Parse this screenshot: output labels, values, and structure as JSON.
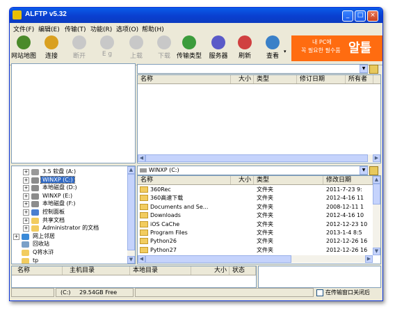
{
  "window": {
    "title": "ALFTP v5.32",
    "controls": [
      "_",
      "□",
      "×"
    ]
  },
  "menu": [
    "文件(F)",
    "编辑(E)",
    "传输(T)",
    "功能(R)",
    "选项(O)",
    "帮助(H)"
  ],
  "toolbar": [
    {
      "label": "网站地图",
      "icon": "site-map-icon",
      "enabled": true,
      "color": "#4a8a2a"
    },
    {
      "label": "连接",
      "icon": "connect-icon",
      "enabled": true,
      "color": "#d9a020"
    },
    {
      "label": "断开",
      "icon": "disconnect-icon",
      "enabled": false,
      "color": "#c8c8c8"
    },
    {
      "label": "E g",
      "icon": "edit-icon",
      "enabled": false,
      "color": "#c8c8c8"
    },
    {
      "label": "上载",
      "icon": "upload-icon",
      "enabled": false,
      "color": "#c8c8c8"
    },
    {
      "label": "下载",
      "icon": "download-icon",
      "enabled": false,
      "color": "#c8c8c8"
    },
    {
      "label": "传输类型",
      "icon": "transfer-type-icon",
      "enabled": true,
      "color": "#3c9c3c"
    },
    {
      "label": "服务器",
      "icon": "server-icon",
      "enabled": true,
      "color": "#5a5ac8"
    },
    {
      "label": "刷新",
      "icon": "refresh-icon",
      "enabled": true,
      "color": "#d04040"
    },
    {
      "label": "查看",
      "icon": "view-icon",
      "enabled": true,
      "color": "#3a80c8"
    }
  ],
  "ad_banner": {
    "line1": "내 PC에",
    "line2": "꼭 필요한 필수품",
    "big": "알툴"
  },
  "remote": {
    "path": "",
    "columns": [
      "名称",
      "大小",
      "类型",
      "修订日期",
      "所有者"
    ]
  },
  "local": {
    "path": "WINXP (C:)",
    "columns": [
      "名称",
      "大小",
      "类型",
      "修改日期"
    ],
    "rows": [
      {
        "name": "360Rec",
        "size": "",
        "type": "文件夹",
        "date": "2011-7-23 9:"
      },
      {
        "name": "360高速下载",
        "size": "",
        "type": "文件夹",
        "date": "2012-4-16 11"
      },
      {
        "name": "Documents and Se...",
        "size": "",
        "type": "文件夹",
        "date": "2008-12-11 1"
      },
      {
        "name": "Downloads",
        "size": "",
        "type": "文件夹",
        "date": "2012-4-16 10"
      },
      {
        "name": "iOS CaChe",
        "size": "",
        "type": "文件夹",
        "date": "2012-12-23 10"
      },
      {
        "name": "Program Files",
        "size": "",
        "type": "文件夹",
        "date": "2013-1-4 8:5"
      },
      {
        "name": "Python26",
        "size": "",
        "type": "文件夹",
        "date": "2012-12-26 16"
      },
      {
        "name": "Python27",
        "size": "",
        "type": "文件夹",
        "date": "2012-12-26 16"
      }
    ]
  },
  "tree": [
    {
      "label": "3.5 软盘 (A:)",
      "level": 1,
      "expander": "+",
      "icon": "floppy-icon",
      "selected": false
    },
    {
      "label": "WINXP (C:)",
      "level": 1,
      "expander": "+",
      "icon": "drive-icon",
      "selected": true
    },
    {
      "label": "本地磁盘 (D:)",
      "level": 1,
      "expander": "+",
      "icon": "drive-icon",
      "selected": false
    },
    {
      "label": "WINXP (E:)",
      "level": 1,
      "expander": "+",
      "icon": "drive-icon",
      "selected": false
    },
    {
      "label": "本地磁盘 (F:)",
      "level": 1,
      "expander": "+",
      "icon": "drive-icon",
      "selected": false
    },
    {
      "label": "控制面板",
      "level": 1,
      "expander": "+",
      "icon": "control-panel-icon",
      "selected": false
    },
    {
      "label": "共享文档",
      "level": 1,
      "expander": "+",
      "icon": "folder-icon",
      "selected": false
    },
    {
      "label": "Administrator 的文档",
      "level": 1,
      "expander": "+",
      "icon": "folder-icon",
      "selected": false
    },
    {
      "label": "网上邻居",
      "level": 0,
      "expander": "+",
      "icon": "network-icon",
      "selected": false
    },
    {
      "label": "回收站",
      "level": 0,
      "expander": "",
      "icon": "recycle-bin-icon",
      "selected": false
    },
    {
      "label": "Q将水浒",
      "level": 0,
      "expander": "",
      "icon": "folder-icon",
      "selected": false
    },
    {
      "label": "tp",
      "level": 0,
      "expander": "",
      "icon": "folder-icon",
      "selected": false
    }
  ],
  "queue": {
    "columns": [
      "名称",
      "主机目录",
      "本地目录",
      "大小",
      "状态"
    ]
  },
  "status": {
    "drive": "(C:)",
    "free": "29.54GB Free",
    "close_after_transfer": "在传输窗口关闭后"
  }
}
